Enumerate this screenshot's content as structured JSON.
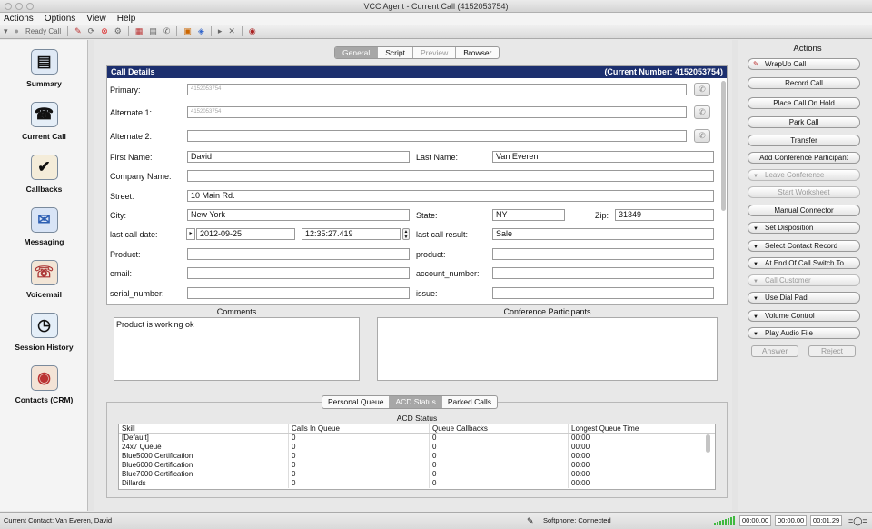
{
  "window": {
    "title": "VCC Agent - Current Call (4152053754)"
  },
  "menu": [
    "Actions",
    "Options",
    "View",
    "Help"
  ],
  "toolbar": {
    "status": "Ready Call"
  },
  "nav": [
    {
      "label": "Summary",
      "icon": "summary-icon"
    },
    {
      "label": "Current Call",
      "icon": "current-call-icon"
    },
    {
      "label": "Callbacks",
      "icon": "callbacks-icon"
    },
    {
      "label": "Messaging",
      "icon": "messaging-icon"
    },
    {
      "label": "Voicemail",
      "icon": "voicemail-icon"
    },
    {
      "label": "Session History",
      "icon": "session-history-icon"
    },
    {
      "label": "Contacts (CRM)",
      "icon": "contacts-icon"
    }
  ],
  "tabs": [
    {
      "label": "General",
      "state": "active"
    },
    {
      "label": "Script",
      "state": "normal"
    },
    {
      "label": "Preview",
      "state": "disabled"
    },
    {
      "label": "Browser",
      "state": "normal"
    }
  ],
  "details": {
    "title": "Call Details",
    "current_number": "(Current Number: 4152053754)",
    "primary_label": "Primary:",
    "primary_value": "4152053754",
    "alternate1_label": "Alternate 1:",
    "alternate1_value": "4152053754",
    "alternate2_label": "Alternate 2:",
    "alternate2_value": "",
    "first_name_label": "First Name:",
    "first_name": "David",
    "last_name_label": "Last Name:",
    "last_name": "Van Everen",
    "company_label": "Company Name:",
    "company": "",
    "street_label": "Street:",
    "street": "10 Main Rd.",
    "city_label": "City:",
    "city": "New York",
    "state_label": "State:",
    "state": "NY",
    "zip_label": "Zip:",
    "zip": "31349",
    "last_call_date_label": "last call date:",
    "last_call_date": "2012-09-25",
    "last_call_time": "12:35:27.419",
    "last_call_result_label": "last call result:",
    "last_call_result": "Sale",
    "product_label": "Product:",
    "product": "",
    "product2_label": "product:",
    "product2": "",
    "email_label": "email:",
    "email": "",
    "account_label": "account_number:",
    "account": "",
    "serial_label": "serial_number:",
    "serial": "",
    "issue_label": "issue:",
    "issue": ""
  },
  "comments": {
    "title": "Comments",
    "text": "Product is working ok"
  },
  "conference": {
    "title": "Conference Participants"
  },
  "queue_tabs": [
    {
      "label": "Personal Queue",
      "state": "normal"
    },
    {
      "label": "ACD Status",
      "state": "active"
    },
    {
      "label": "Parked Calls",
      "state": "normal"
    }
  ],
  "acd": {
    "title": "ACD Status",
    "columns": [
      "Skill",
      "Calls In Queue",
      "Queue Callbacks",
      "Longest Queue Time"
    ],
    "rows": [
      [
        "[Default]",
        "0",
        "0",
        "00:00"
      ],
      [
        "24x7 Queue",
        "0",
        "0",
        "00:00"
      ],
      [
        "Blue5000 Certification",
        "0",
        "0",
        "00:00"
      ],
      [
        "Blue6000 Certification",
        "0",
        "0",
        "00:00"
      ],
      [
        "Blue7000 Certification",
        "0",
        "0",
        "00:00"
      ],
      [
        "Dillards",
        "0",
        "0",
        "00:00"
      ]
    ]
  },
  "actions": {
    "title": "Actions",
    "buttons": [
      {
        "label": "WrapUp Call",
        "kind": "icon",
        "enabled": true
      },
      {
        "label": "Record Call",
        "kind": "plain",
        "enabled": true
      },
      {
        "label": "Place Call On Hold",
        "kind": "plain",
        "enabled": true
      },
      {
        "label": "Park Call",
        "kind": "plain",
        "enabled": true
      },
      {
        "label": "Transfer",
        "kind": "plain",
        "enabled": true
      },
      {
        "label": "Add Conference Participant",
        "kind": "plain",
        "enabled": true
      },
      {
        "label": "Leave Conference",
        "kind": "dropdown",
        "enabled": false
      },
      {
        "label": "Start Worksheet",
        "kind": "plain",
        "enabled": false
      },
      {
        "label": "Manual Connector",
        "kind": "plain",
        "enabled": true
      },
      {
        "label": "Set Disposition",
        "kind": "dropdown",
        "enabled": true
      },
      {
        "label": "Select Contact Record",
        "kind": "dropdown",
        "enabled": true
      },
      {
        "label": "At End Of Call Switch To",
        "kind": "dropdown",
        "enabled": true
      },
      {
        "label": "Call Customer",
        "kind": "dropdown",
        "enabled": false
      },
      {
        "label": "Use Dial Pad",
        "kind": "dropdown",
        "enabled": true
      },
      {
        "label": "Volume Control",
        "kind": "dropdown",
        "enabled": true
      },
      {
        "label": "Play Audio File",
        "kind": "dropdown",
        "enabled": true
      }
    ],
    "answer": "Answer",
    "reject": "Reject"
  },
  "statusbar": {
    "contact": "Current Contact: Van Everen, David",
    "softphone": "Softphone: Connected",
    "timer1": "00:00.00",
    "timer2": "00:00.00",
    "timer3": "00:01.29"
  },
  "colors": {
    "header": "#1c2f6e",
    "signal": "#3fb93f"
  }
}
